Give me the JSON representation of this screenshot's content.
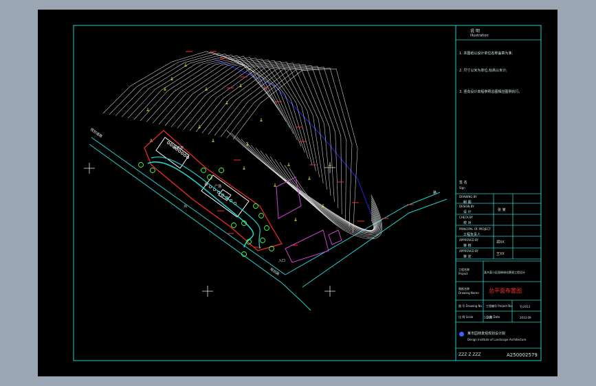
{
  "notes": {
    "heading": "说 明",
    "heading_en": "Illustration",
    "items": [
      "1. 本图纸以设计单位名称盖章为准;",
      "2. 尺寸以米为单位,标高以米计;",
      "3. 竖向设计高程参照总图相应图例执行。"
    ]
  },
  "approval": {
    "label": "签 名",
    "label_en": "Sign",
    "rows": [
      {
        "en": "DRAWING BY",
        "cn": "制 图",
        "value": ""
      },
      {
        "en": "DESIGN BY",
        "cn": "设 计",
        "value": "张 某"
      },
      {
        "en": "CHECK BY",
        "cn": "校 对",
        "value": ""
      },
      {
        "en": "PRINCIPAL OF PROJECT",
        "cn": "工程负责人",
        "value": ""
      },
      {
        "en": "APPROVED BY",
        "cn": "审 核",
        "value": "郑XX"
      },
      {
        "en": "APPROVED BY",
        "cn": "审 定",
        "value": "王XX"
      }
    ]
  },
  "project": {
    "label": "工程名称 Project",
    "name": "某市某小区园林绿化景观工程设计"
  },
  "drawing": {
    "label": "图纸名称 Drawing Name",
    "title": "总平面布置图"
  },
  "meta": [
    {
      "label": "图 号 Drawing No.",
      "value": "",
      "label2": "工程编号 Project No.",
      "value2": "YJ-2013"
    },
    {
      "label": "比 例 Scale",
      "value": "1:200",
      "label2": "日 期 Date",
      "value2": "2013.09"
    }
  ],
  "company": {
    "name": "某市园林景观规划设计院",
    "name_en": "Design Institute of Landscape Architecture"
  },
  "footer": {
    "left": "ZZZ Z ZZZ",
    "code": "A250002579"
  },
  "plan_labels": {
    "road_west": "规划道路",
    "road_south": "规划路",
    "road_east": "路",
    "pavilion": "休息亭",
    "plaza": "广场",
    "gate": "入口",
    "north": "N"
  },
  "colors": {
    "frame": "#2ad0d0",
    "contour": "#f0f0f0",
    "boundary": "#ff2a2a",
    "building": "#d040d0",
    "water": "#24d0d0",
    "tree": "#44ff44",
    "river": "#2020c0",
    "tree_symbol": "#f0f040"
  }
}
